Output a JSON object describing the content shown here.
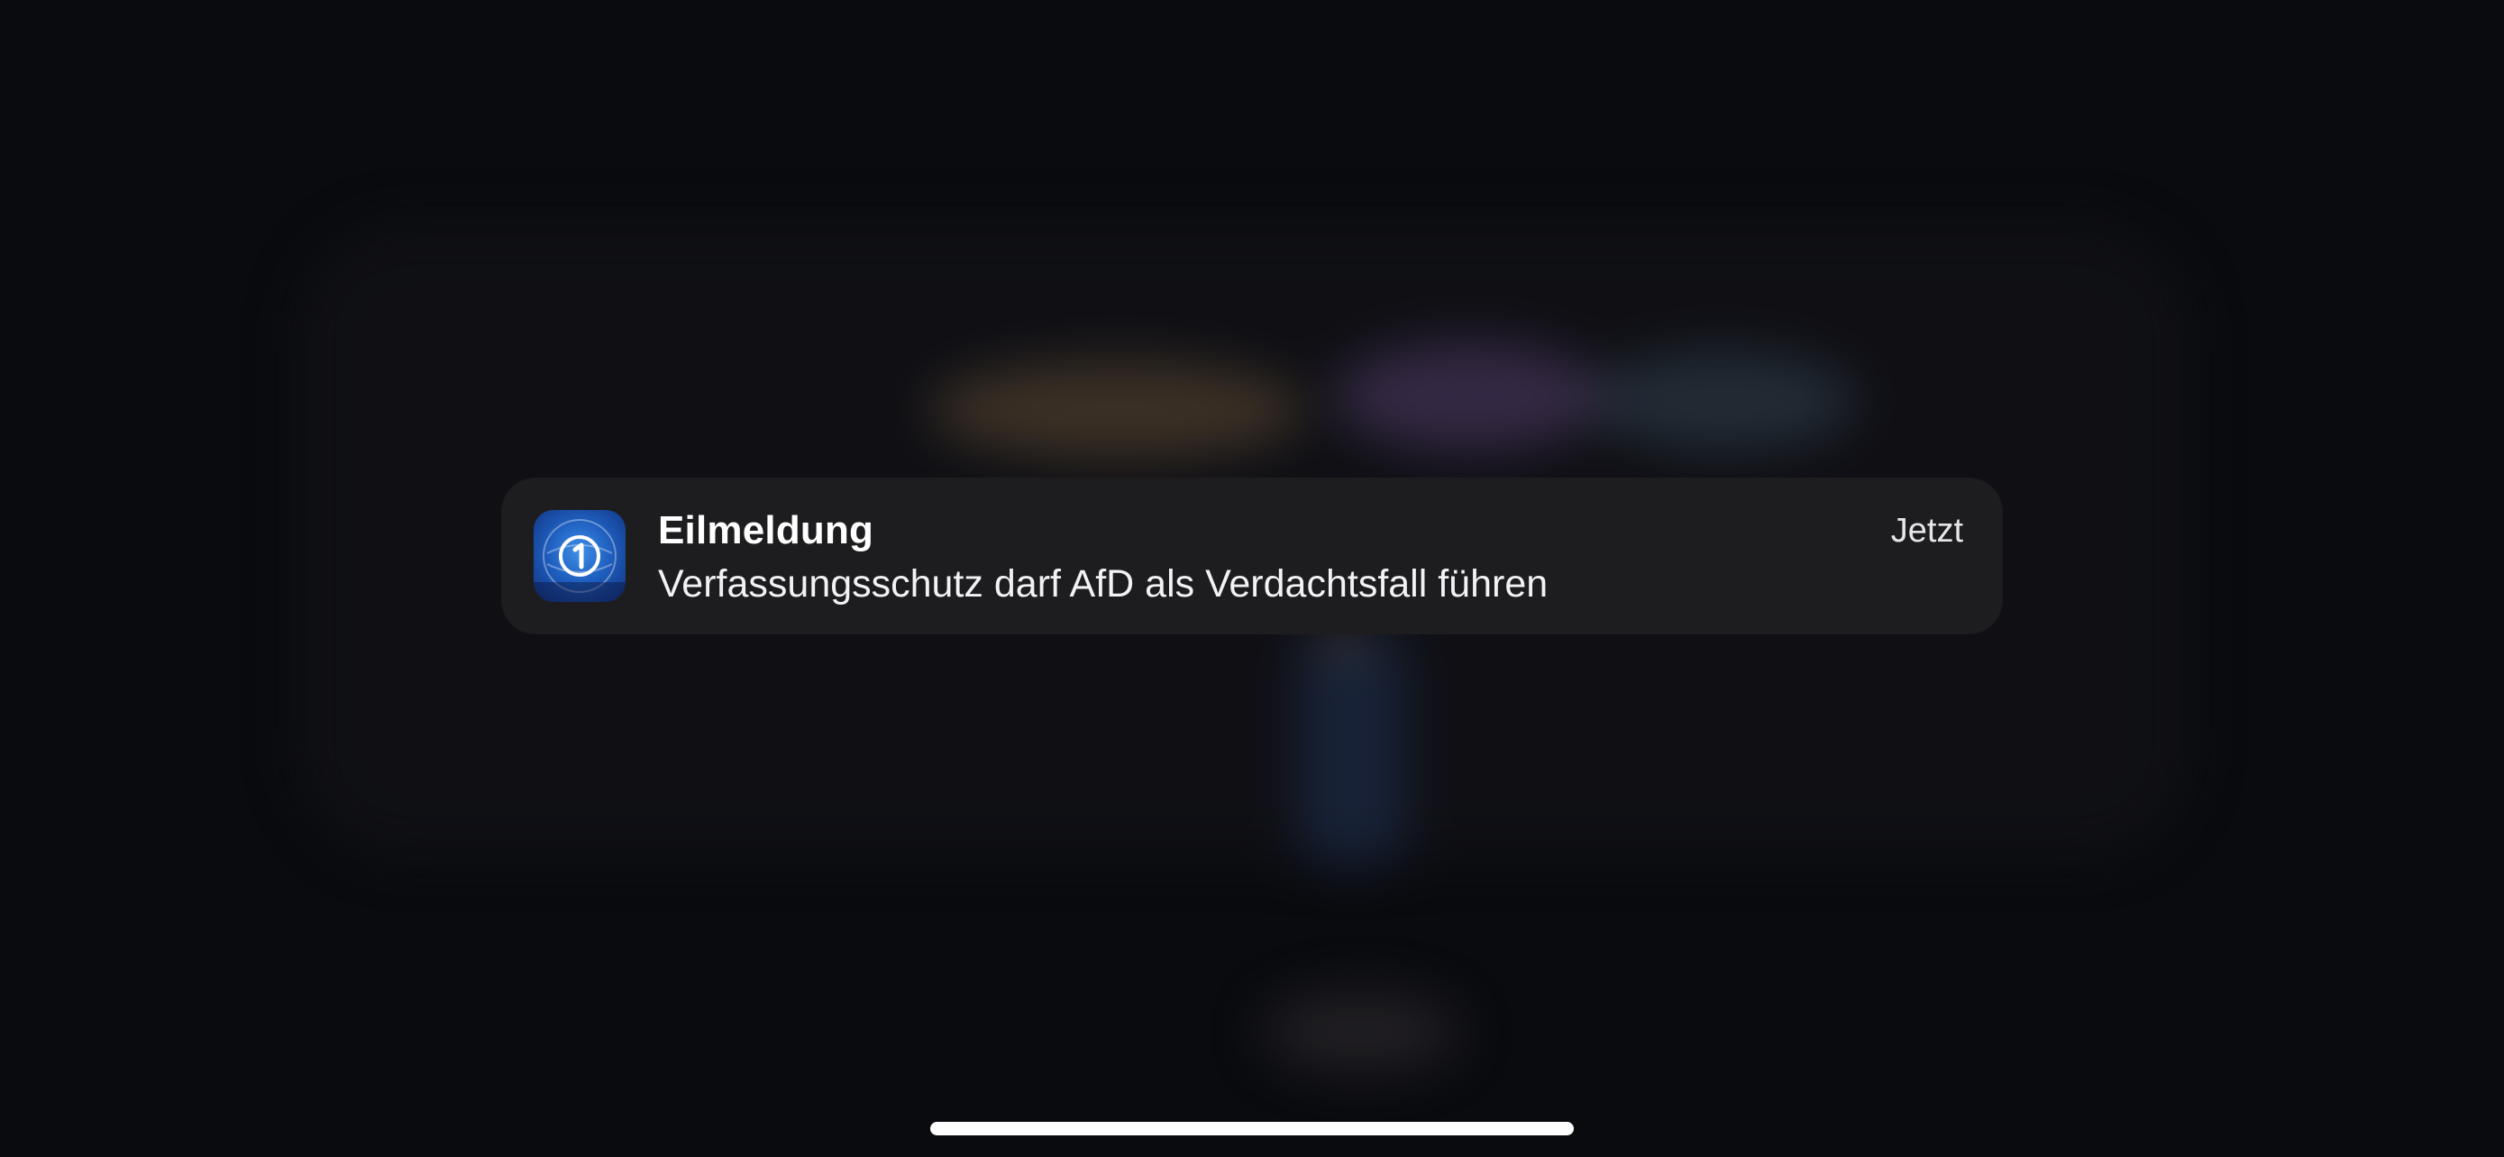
{
  "notification": {
    "app_icon": "tagesschau-globe-icon",
    "title": "Eilmeldung",
    "message": "Verfassungsschutz darf AfD als Verdachtsfall führen",
    "time": "Jetzt"
  },
  "colors": {
    "background": "#0a0b0f",
    "card": "#1d1d1f",
    "text": "#ffffff",
    "icon_blue": "#1f5fbf"
  }
}
